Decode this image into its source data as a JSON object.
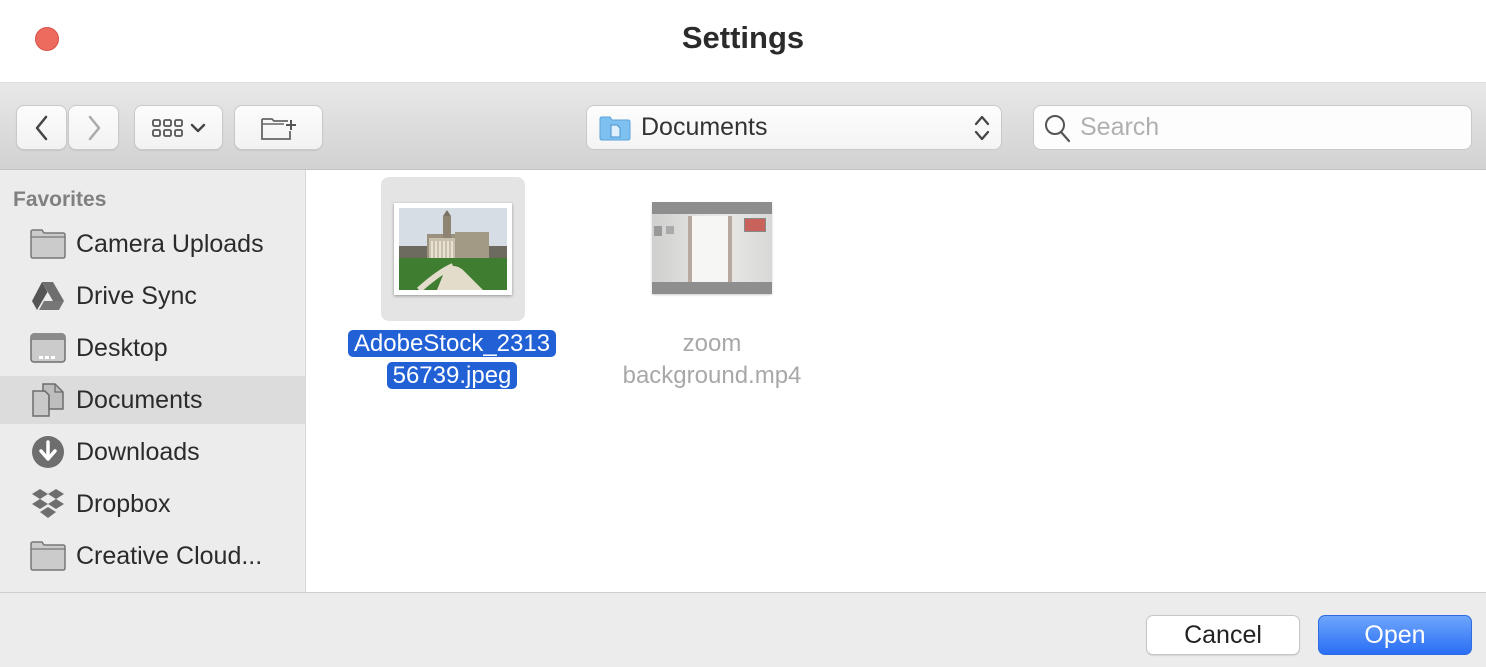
{
  "window": {
    "title": "Settings"
  },
  "toolbar": {
    "back_icon": "chevron-left-icon",
    "forward_icon": "chevron-right-icon",
    "view_icon": "icon-grid-view-icon",
    "new_folder_icon": "new-folder-icon",
    "location": {
      "label": "Documents",
      "icon": "documents-folder-icon"
    },
    "search": {
      "placeholder": "Search",
      "value": ""
    }
  },
  "sidebar": {
    "heading": "Favorites",
    "items": [
      {
        "label": "Camera Uploads",
        "icon": "folder-icon",
        "selected": false
      },
      {
        "label": "Drive Sync",
        "icon": "google-drive-icon",
        "selected": false
      },
      {
        "label": "Desktop",
        "icon": "desktop-icon",
        "selected": false
      },
      {
        "label": "Documents",
        "icon": "documents-icon",
        "selected": true
      },
      {
        "label": "Downloads",
        "icon": "downloads-icon",
        "selected": false
      },
      {
        "label": "Dropbox",
        "icon": "dropbox-icon",
        "selected": false
      },
      {
        "label": "Creative Cloud...",
        "icon": "folder-icon",
        "selected": false
      }
    ]
  },
  "files": [
    {
      "name_line1": "AdobeStock_2313",
      "name_line2": "56739.jpeg",
      "type": "image",
      "selected": true
    },
    {
      "name_line1": "zoom",
      "name_line2": "background.mp4",
      "type": "video",
      "selected": false,
      "disabled": true
    }
  ],
  "footer": {
    "cancel_label": "Cancel",
    "open_label": "Open"
  },
  "colors": {
    "accent": "#2a6ef5",
    "selection": "#2260d6",
    "close": "#ed6a5e"
  }
}
